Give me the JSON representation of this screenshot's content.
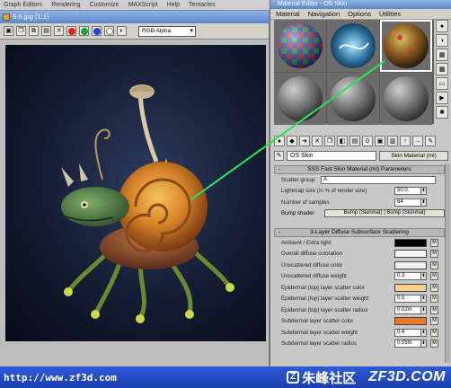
{
  "app_menu": {
    "items": [
      "Graph Editors",
      "Rendering",
      "Customize",
      "MAXScript",
      "Help",
      "Tentacles"
    ]
  },
  "render_window": {
    "title": "9-6.jpg (1:1)",
    "channel_select": "RGB Alpha",
    "colors": {
      "red": "#e02020",
      "green": "#20a040",
      "blue": "#2040e0",
      "mono": "#ffffff"
    }
  },
  "material_editor": {
    "title": "Material Editor - OS Skin",
    "menu": [
      "Material",
      "Navigation",
      "Options",
      "Utilities"
    ],
    "material_name": "OS Skin",
    "material_type": "Skin Material (mi)",
    "sss_rollout": {
      "title": "SSS Fast Skin Material (mi) Parameters",
      "scatter_group_label": "Scatter group:",
      "scatter_group_value": "A",
      "rows": [
        {
          "label": "Lightmap size (in % of render size)",
          "value": "50.0"
        },
        {
          "label": "Number of samples",
          "value": "64"
        }
      ],
      "bump_label": "Bump shader",
      "bump_value": "Bump (Skinmat) | Bump (Skinmat)"
    },
    "diffuse_rollout": {
      "title": "3-Layer Diffuse Subsurface Scattering",
      "rows": [
        {
          "label": "Ambient / Extra light",
          "swatch": "#050505"
        },
        {
          "label": "Overall diffuse coloration",
          "swatch": "#f4f4f4"
        },
        {
          "label": "Unscattered diffuse color",
          "swatch": "#f0f0f0"
        },
        {
          "label": "Unscattered diffuse weight",
          "value": "0.3"
        },
        {
          "label": "Epidermal (top) layer scatter color",
          "swatch": "#f6cf8c"
        },
        {
          "label": "Epidermal (top) layer scatter weight",
          "value": "0.5"
        },
        {
          "label": "Epidermal (top) layer scatter radius",
          "value": "0.02m"
        },
        {
          "label": "Subdermal layer scatter color",
          "swatch": "#e8782a"
        },
        {
          "label": "Subdermal layer scatter weight",
          "value": "0.4"
        },
        {
          "label": "Subdermal layer scatter radius",
          "value": "0.05m"
        }
      ]
    }
  },
  "footer": {
    "url": "http://www.zf3d.com",
    "logo_zh": "朱峰社区",
    "logo_en": "ZF3D.COM"
  }
}
